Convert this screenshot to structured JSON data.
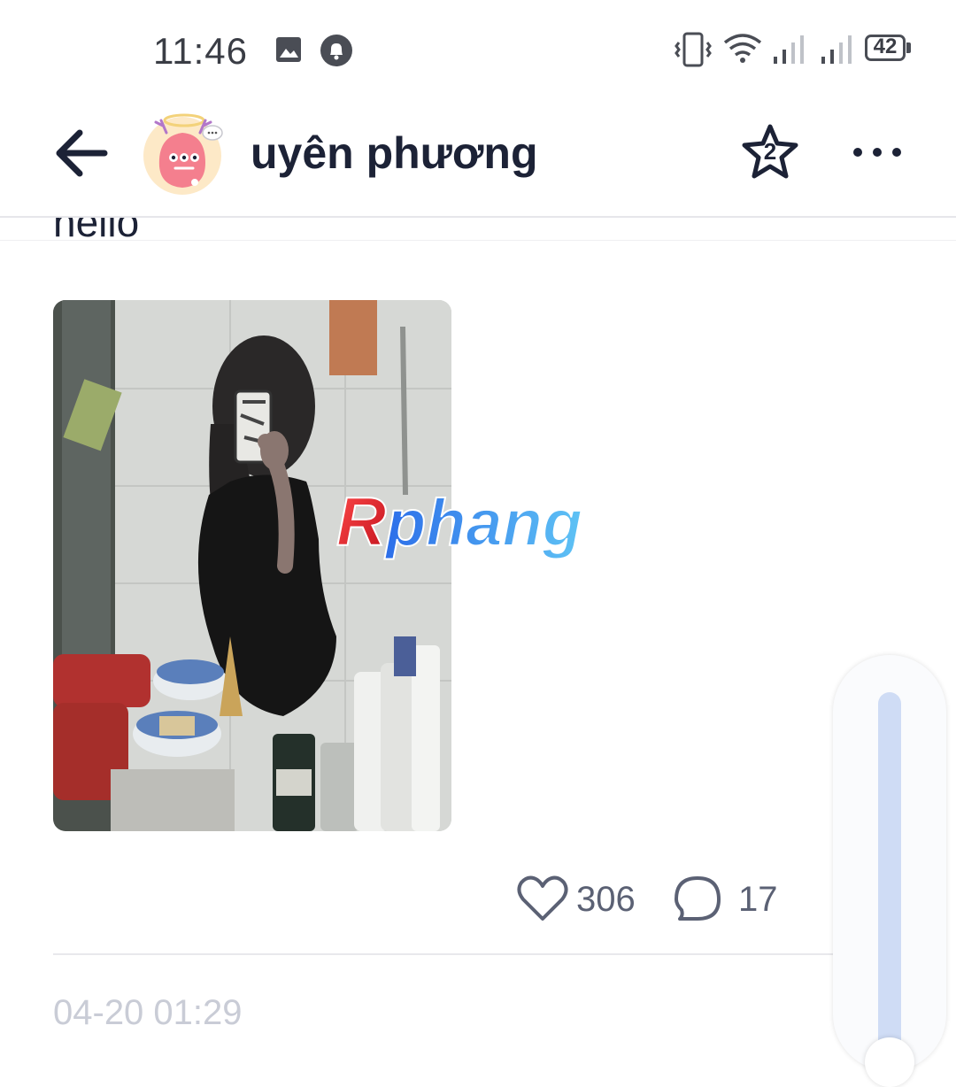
{
  "status_bar": {
    "time": "11:46",
    "battery": "42",
    "icons": [
      "image-icon",
      "notification-bell-icon",
      "vibrate-icon",
      "wifi-icon",
      "signal-icon",
      "signal-icon",
      "battery-icon"
    ]
  },
  "header": {
    "user_name": "uyên phương",
    "back_icon": "arrow-left-icon",
    "star_badge": "2",
    "more_icon": "more-dots-icon"
  },
  "post": {
    "text": "hello",
    "watermark": "Rphang",
    "likes": "306",
    "comments": "17",
    "date": "04-20 01:29"
  },
  "colors": {
    "text_primary": "#1c2236",
    "text_secondary": "#5b6174",
    "date_text": "#c9ccd6",
    "scroll_track": "#cfdcf5"
  }
}
